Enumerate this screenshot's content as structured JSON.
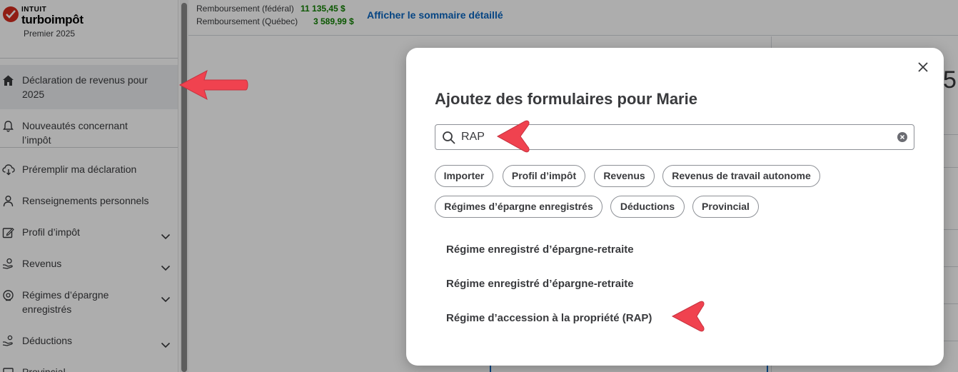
{
  "brand": {
    "company": "INTUIT",
    "product": "turboimpôt",
    "edition": "Premier 2025"
  },
  "sidebar": {
    "items": [
      {
        "label": "Déclaration de revenus pour 2025",
        "icon": "home-icon",
        "active": true
      },
      {
        "label": "Nouveautés concernant l’impôt",
        "icon": "bell-icon"
      },
      {
        "label": "Préremplir ma déclaration",
        "icon": "cloud-download-icon"
      },
      {
        "label": "Renseignements personnels",
        "icon": "person-icon"
      },
      {
        "label": "Profil d’impôt",
        "icon": "edit-icon",
        "expandable": true
      },
      {
        "label": "Revenus",
        "icon": "hand-money-icon",
        "expandable": true
      },
      {
        "label": "Régimes d’épargne enregistrés",
        "icon": "savings-icon",
        "expandable": true
      },
      {
        "label": "Déductions",
        "icon": "deductions-icon",
        "expandable": true
      },
      {
        "label": "Provincial",
        "icon": "provincial-icon",
        "expandable": true
      }
    ]
  },
  "topbar": {
    "refund_federal_label": "Remboursement (fédéral)",
    "refund_federal_amount": "11 135,45 $",
    "refund_quebec_label": "Remboursement (Québec)",
    "refund_quebec_amount": "3 589,99 $",
    "detail_link": "Afficher le sommaire détaillé"
  },
  "background": {
    "partial_digit": "5"
  },
  "modal": {
    "title": "Ajoutez des formulaires pour Marie",
    "search_value": "RAP",
    "chips": [
      "Importer",
      "Profil d’impôt",
      "Revenus",
      "Revenus de travail autonome",
      "Régimes d’épargne enregistrés",
      "Déductions",
      "Provincial"
    ],
    "results": [
      "Régime enregistré d’épargne-retraite",
      "Régime enregistré d’épargne-retraite",
      "Régime d’accession à la propriété (RAP)"
    ]
  },
  "colors": {
    "accent_link": "#0a66c2",
    "refund_green": "#108000",
    "annotation_arrow": "#f0424f",
    "brand_red": "#d52b1e"
  }
}
